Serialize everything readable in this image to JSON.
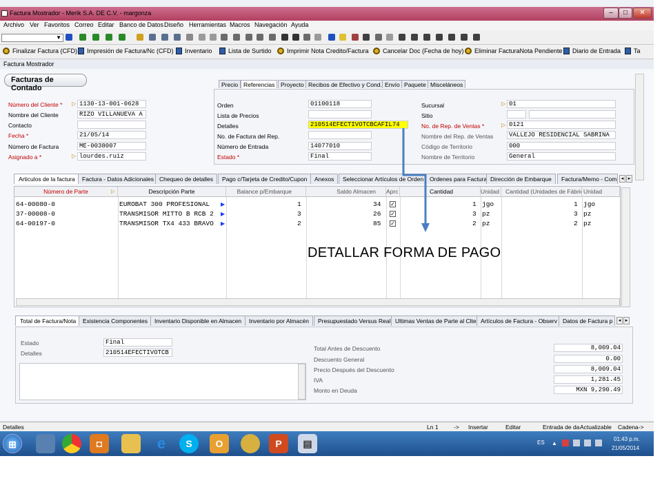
{
  "window": {
    "title": "Factura Mostrador - Merik S.A. DE C.V. - margonza",
    "minimize": "–",
    "maximize": "□",
    "close": "✕"
  },
  "menu": [
    "Archivo",
    "Ver",
    "Favoritos",
    "Correo",
    "Editar",
    "Banco de Datos",
    "Diseño",
    "Herramientas",
    "Macros",
    "Navegación",
    "Ayuda"
  ],
  "toolbar2": [
    "Finalizar Factura (CFD)",
    "Impresión de Factura/Nc (CFD)",
    "Inventario",
    "Lista de Surtido",
    "Imprimir Nota Credito/Factura",
    "Cancelar Doc (Fecha de hoy)",
    "Eliminar FacturaNota Pendiente",
    "Diario de Entrada",
    "Ta"
  ],
  "doc_tab": "Factura Mostrador",
  "form": {
    "header": "Facturas de Contado",
    "left": [
      {
        "label": "Número del Cliente *",
        "value": "1130-13-001-0628"
      },
      {
        "label": "Nombre del Cliente",
        "value": "RIZO VILLANUEVA A"
      },
      {
        "label": "Contacto",
        "value": ""
      },
      {
        "label": "Fecha *",
        "value": "21/05/14"
      },
      {
        "label": "Número de Factura",
        "value": "ME-0038007"
      },
      {
        "label": "Asignado a *",
        "value": "lourdes.ruiz"
      }
    ],
    "top_tabs": [
      "Precio",
      "Referencias",
      "Proyecto",
      "Recibos de Efectivo y Cond.",
      "Envío",
      "Paquete",
      "Misceláneos"
    ],
    "mid": [
      {
        "label": "Orden",
        "value": "01100118"
      },
      {
        "label": "Lista de Precios",
        "value": ""
      },
      {
        "label": "Detalles",
        "value": "210514EFECTIVOTCBCAFIL74"
      },
      {
        "label": "No. de Factura del Rep.",
        "value": ""
      },
      {
        "label": "Número de Entrada",
        "value": "14077010"
      },
      {
        "label": "Estado *",
        "value": "Final"
      }
    ],
    "right": [
      {
        "label": "Sucursal",
        "value": "01"
      },
      {
        "label": "Sitio",
        "value": ""
      },
      {
        "label": "No. de Rep. de Ventas *",
        "value": "0121"
      },
      {
        "label": "Nombre del Rep. de Ventas",
        "value": "VALLEJO RESIDENCIAL SABRINA"
      },
      {
        "label": "Código de Territorio",
        "value": "000"
      },
      {
        "label": "Nombre de Territorio",
        "value": "General"
      }
    ]
  },
  "detail_tabs": [
    "Articulos de la factura",
    "Factura - Datos Adicionales",
    "Chequeo de detalles",
    "Pago c/Tarjeta de Credito/Cupon",
    "Anexos",
    "Seleccionar Artículos de Orden",
    "Ordenes para Factura",
    "Dirección de Embarque",
    "Factura/Memo - Com"
  ],
  "grid": {
    "headers": [
      "Número de Parte",
      "Descripción Parte",
      "Balance p/Embarque",
      "Saldo Almacen",
      "Aprc",
      "Cantidad",
      "Unidad",
      "Cantidad (Unidades de Fábrica)",
      "Unidad"
    ],
    "rows": [
      [
        "64-00080-0",
        "EUROBAT 300 PROFESIONAL",
        "1",
        "34",
        "✓",
        "1",
        "jgo",
        "1",
        "jgo"
      ],
      [
        "37-00008-0",
        "TRANSMISOR MITTO B RCB 2",
        "3",
        "26",
        "✓",
        "3",
        "pz",
        "3",
        "pz"
      ],
      [
        "64-00197-0",
        "TRANSMISOR TX4 433 BRAVO",
        "2",
        "85",
        "✓",
        "2",
        "pz",
        "2",
        "pz"
      ]
    ]
  },
  "annotation": "DETALLAR FORMA DE PAGO",
  "bottom_tabs": [
    "Total de Factura/Nota",
    "Existencia Componentes",
    "Inventario Disponible en Almacen",
    "Inventario por Almacén",
    "Presupuestado Versus Real",
    "Ultimas Ventas de Parte al Clte",
    "Artículos de Factura - Observ",
    "Datos de Factura p"
  ],
  "bottom_left": [
    {
      "label": "Estado",
      "value": "Final"
    },
    {
      "label": "Detalles",
      "value": "210514EFECTIVOTCB"
    }
  ],
  "totals": [
    {
      "label": "Total Antes de Descuento",
      "value": "8,009.04"
    },
    {
      "label": "Descuento General",
      "value": "0.00"
    },
    {
      "label": "Precio Después del Descuento",
      "value": "8,009.04"
    },
    {
      "label": "IVA",
      "value": "1,281.45"
    },
    {
      "label": "Monto en Deuda",
      "value": "MXN 9,290.49"
    }
  ],
  "status": {
    "left": "Detalles",
    "ln": "Ln 1",
    "arrow": "->",
    "mode": "Insertar",
    "edit": "Editar",
    "entry": "Entrada de da",
    "update": "Actualizable",
    "chain": "Cadena->"
  },
  "taskbar": {
    "lang": "ES",
    "time": "01:43 p.m.",
    "date": "21/05/2014"
  },
  "colors": {
    "title": "#b2405f",
    "accent": "#1a3cff",
    "highlight": "#ffff00",
    "annotation_arrow": "#4a7fc1"
  }
}
